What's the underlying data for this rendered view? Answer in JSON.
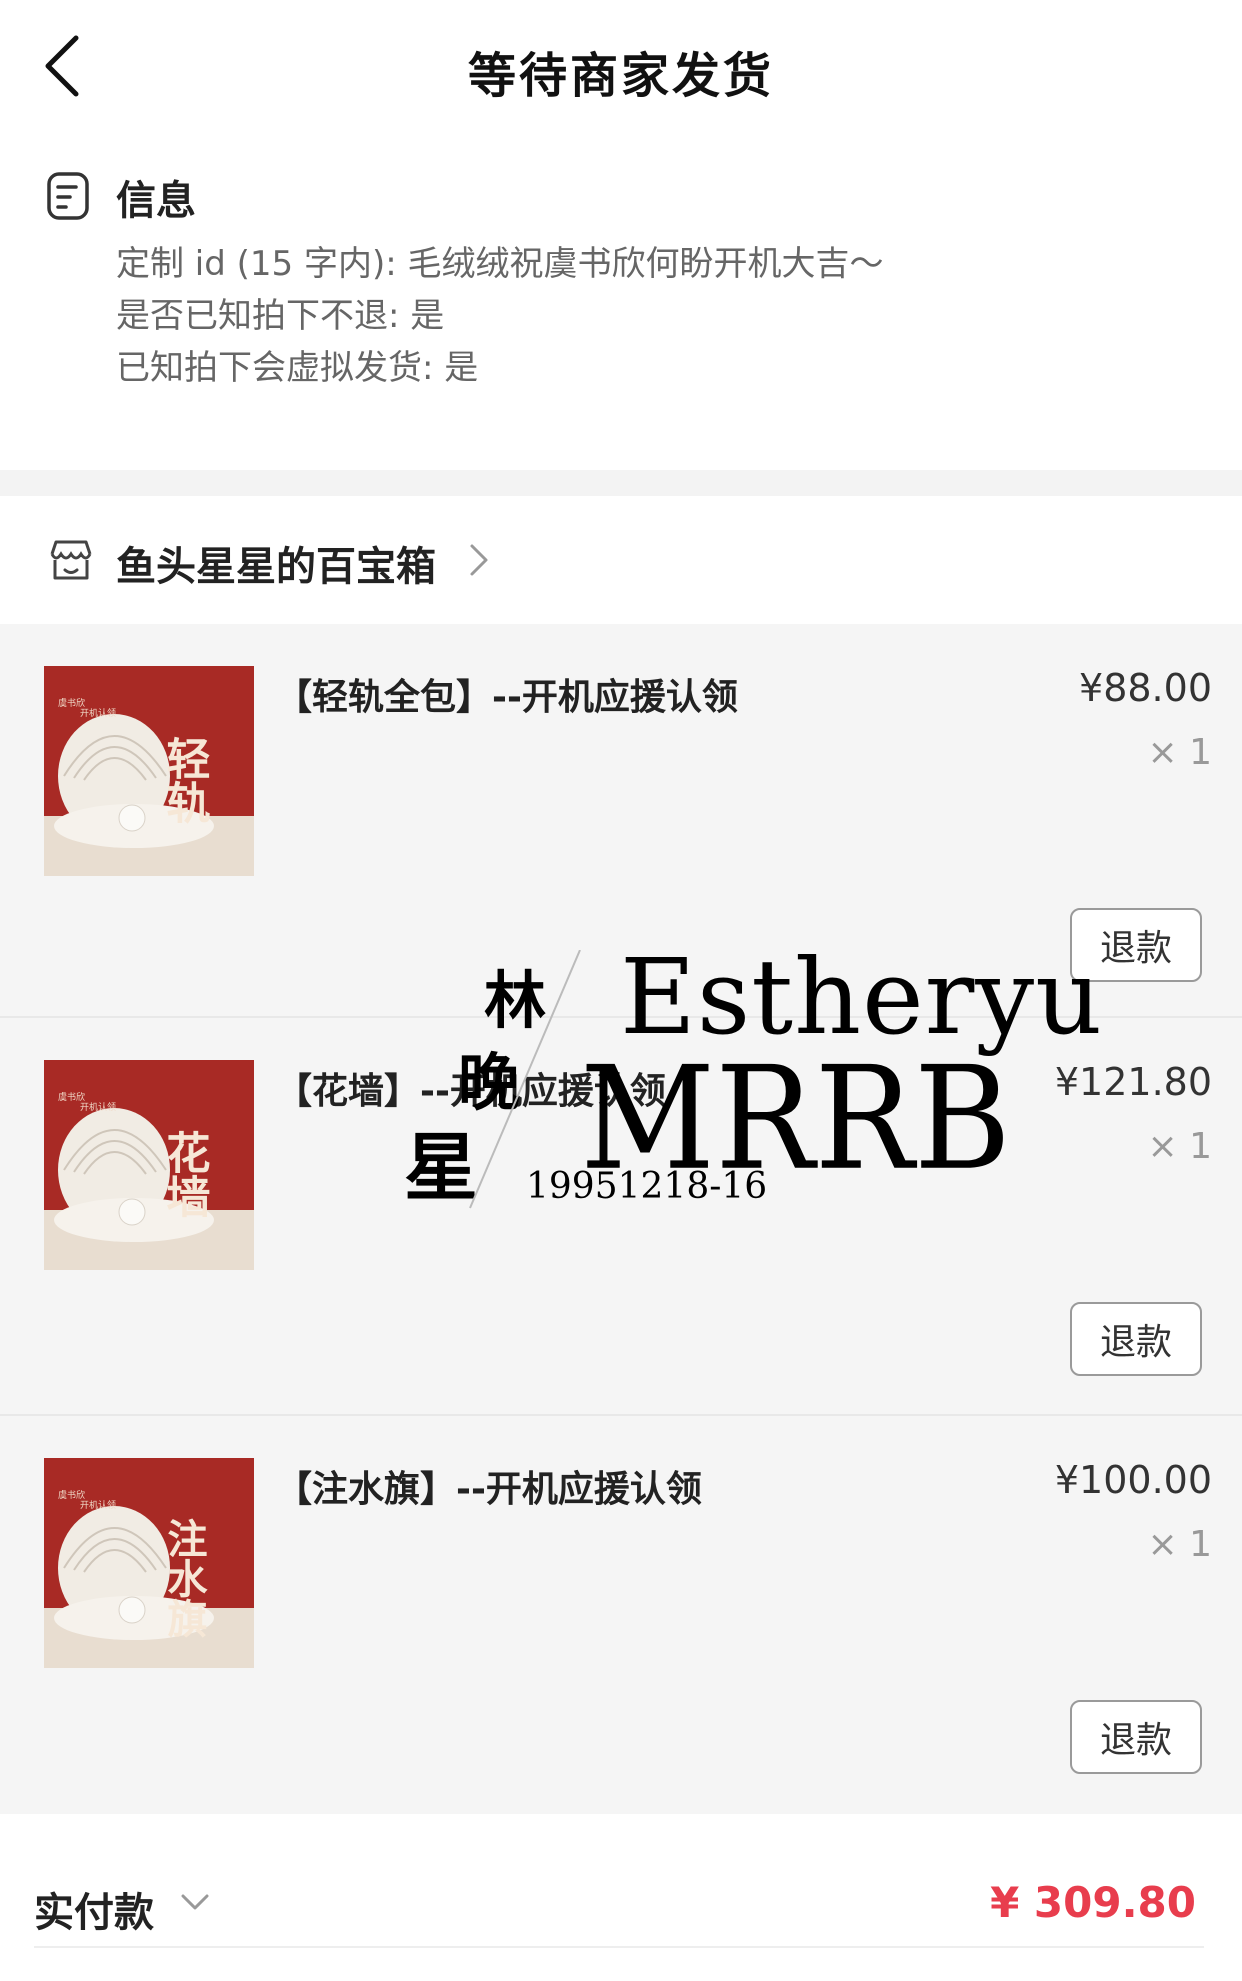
{
  "header": {
    "title": "等待商家发货"
  },
  "info": {
    "title": "信息",
    "lines": [
      "定制 id (15 字内): 毛绒绒祝虞书欣何盼开机大吉～",
      "是否已知拍下不退: 是",
      "已知拍下会虚拟发货: 是"
    ]
  },
  "shop": {
    "name": "鱼头星星的百宝箱"
  },
  "items": [
    {
      "title": "【轻轨全包】--开机应援认领",
      "price": "¥88.00",
      "qty": "× 1",
      "refund": "退款",
      "thumb_text": "轻轨"
    },
    {
      "title": "【花墙】--开机应援认领",
      "price": "¥121.80",
      "qty": "× 1",
      "refund": "退款",
      "thumb_text": "花墙"
    },
    {
      "title": "【注水旗】--开机应援认领",
      "price": "¥100.00",
      "qty": "× 1",
      "refund": "退款",
      "thumb_text": "注水旗"
    }
  ],
  "thumb_small": {
    "name": "虞书欣",
    "tag": "开机认领"
  },
  "footer": {
    "label": "实付款",
    "amount": "¥ 309.80"
  },
  "watermark": {
    "cn_1": "林",
    "cn_2": "晚",
    "cn_3": "星",
    "en": "Estheryu",
    "brand": "MRRB",
    "code": "19951218-16"
  },
  "colors": {
    "accent_price": "#e83d4d",
    "thumb_red": "#a82a25"
  }
}
